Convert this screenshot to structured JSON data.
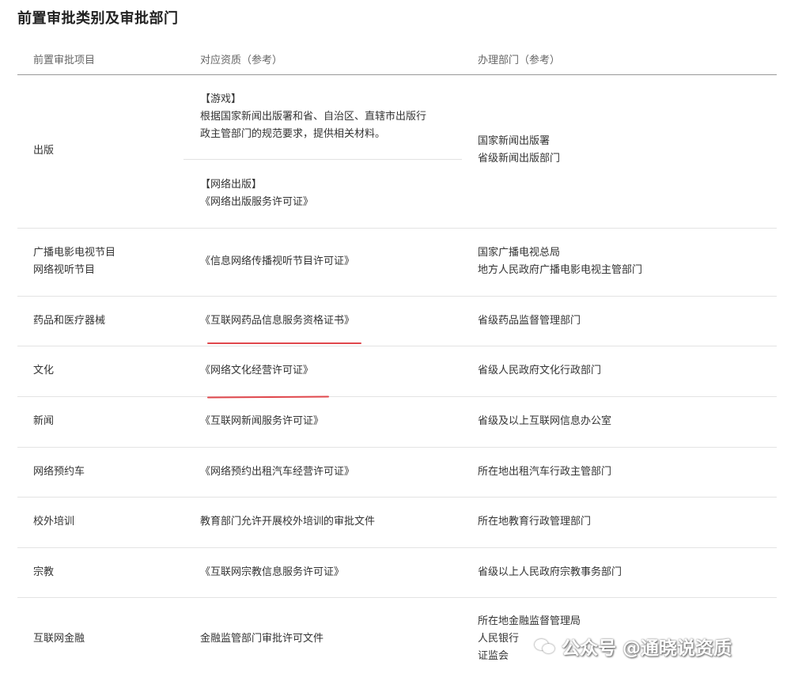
{
  "title": "前置审批类别及审批部门",
  "headers": [
    "前置审批项目",
    "对应资质（参考）",
    "办理部门（参考）"
  ],
  "rows": {
    "publishing": {
      "item": "出版",
      "game_tag": "【游戏】",
      "game_desc_1": "根据国家新闻出版署和省、自治区、直辖市出版行",
      "game_desc_2": "政主管部门的规范要求，提供相关材料。",
      "net_tag": "【网络出版】",
      "net_cert": "《网络出版服务许可证》",
      "dept_1": "国家新闻出版署",
      "dept_2": "省级新闻出版部门"
    },
    "broadcast": {
      "item_1": "广播电影电视节目",
      "item_2": "网络视听节目",
      "cert": "《信息网络传播视听节目许可证》",
      "dept_1": "国家广播电视总局",
      "dept_2": "地方人民政府广播电影电视主管部门"
    },
    "medical": {
      "item": "药品和医疗器械",
      "cert": "《互联网药品信息服务资格证书》",
      "dept": "省级药品监督管理部门"
    },
    "culture": {
      "item": "文化",
      "cert": "《网络文化经营许可证》",
      "dept": "省级人民政府文化行政部门"
    },
    "news": {
      "item": "新闻",
      "cert": "《互联网新闻服务许可证》",
      "dept": "省级及以上互联网信息办公室"
    },
    "ridehail": {
      "item": "网络预约车",
      "cert": "《网络预约出租汽车经营许可证》",
      "dept": "所在地出租汽车行政主管部门"
    },
    "training": {
      "item": "校外培训",
      "cert": "教育部门允许开展校外培训的审批文件",
      "dept": "所在地教育行政管理部门"
    },
    "religion": {
      "item": "宗教",
      "cert": "《互联网宗教信息服务许可证》",
      "dept": "省级以上人民政府宗教事务部门"
    },
    "finance": {
      "item": "互联网金融",
      "cert": "金融监管部门审批许可文件",
      "dept_1": "所在地金融监督管理局",
      "dept_2": "人民银行",
      "dept_3": "证监会"
    }
  },
  "annotations": {
    "underline_color": "#e0474c"
  },
  "watermark": "公众号 @通晓说资质",
  "watermark_icon": "wechat-icon"
}
